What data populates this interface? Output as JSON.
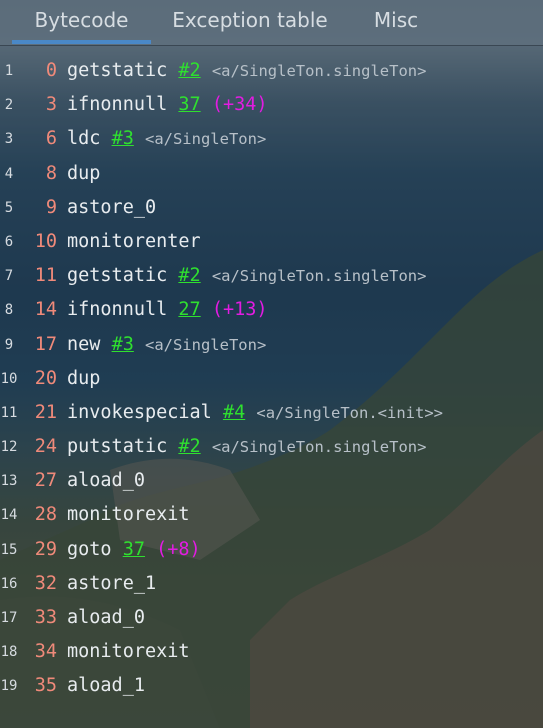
{
  "tabs": [
    {
      "label": "Bytecode",
      "selected": true
    },
    {
      "label": "Exception table",
      "selected": false
    },
    {
      "label": "Misc",
      "selected": false
    }
  ],
  "colors": {
    "offset": "#f08a7a",
    "instruction": "#e8ecef",
    "reference": "#2fe02f",
    "comment": "#b7c0c8",
    "jump": "#e21ce2",
    "tab_underline": "#4a88c7"
  },
  "lines": [
    {
      "num": "1",
      "offset": "0",
      "op": "getstatic",
      "ref": "#2",
      "comment": "<a/SingleTon.singleTon>",
      "jump": ""
    },
    {
      "num": "2",
      "offset": "3",
      "op": "ifnonnull",
      "ref": "37",
      "comment": "",
      "jump": "(+34)"
    },
    {
      "num": "3",
      "offset": "6",
      "op": "ldc",
      "ref": "#3",
      "comment": "<a/SingleTon>",
      "jump": ""
    },
    {
      "num": "4",
      "offset": "8",
      "op": "dup",
      "ref": "",
      "comment": "",
      "jump": ""
    },
    {
      "num": "5",
      "offset": "9",
      "op": "astore_0",
      "ref": "",
      "comment": "",
      "jump": ""
    },
    {
      "num": "6",
      "offset": "10",
      "op": "monitorenter",
      "ref": "",
      "comment": "",
      "jump": ""
    },
    {
      "num": "7",
      "offset": "11",
      "op": "getstatic",
      "ref": "#2",
      "comment": "<a/SingleTon.singleTon>",
      "jump": ""
    },
    {
      "num": "8",
      "offset": "14",
      "op": "ifnonnull",
      "ref": "27",
      "comment": "",
      "jump": "(+13)"
    },
    {
      "num": "9",
      "offset": "17",
      "op": "new",
      "ref": "#3",
      "comment": "<a/SingleTon>",
      "jump": ""
    },
    {
      "num": "10",
      "offset": "20",
      "op": "dup",
      "ref": "",
      "comment": "",
      "jump": ""
    },
    {
      "num": "11",
      "offset": "21",
      "op": "invokespecial",
      "ref": "#4",
      "comment": "<a/SingleTon.<init>>",
      "jump": ""
    },
    {
      "num": "12",
      "offset": "24",
      "op": "putstatic",
      "ref": "#2",
      "comment": "<a/SingleTon.singleTon>",
      "jump": ""
    },
    {
      "num": "13",
      "offset": "27",
      "op": "aload_0",
      "ref": "",
      "comment": "",
      "jump": ""
    },
    {
      "num": "14",
      "offset": "28",
      "op": "monitorexit",
      "ref": "",
      "comment": "",
      "jump": ""
    },
    {
      "num": "15",
      "offset": "29",
      "op": "goto",
      "ref": "37",
      "comment": "",
      "jump": "(+8)"
    },
    {
      "num": "16",
      "offset": "32",
      "op": "astore_1",
      "ref": "",
      "comment": "",
      "jump": ""
    },
    {
      "num": "17",
      "offset": "33",
      "op": "aload_0",
      "ref": "",
      "comment": "",
      "jump": ""
    },
    {
      "num": "18",
      "offset": "34",
      "op": "monitorexit",
      "ref": "",
      "comment": "",
      "jump": ""
    },
    {
      "num": "19",
      "offset": "35",
      "op": "aload_1",
      "ref": "",
      "comment": "",
      "jump": ""
    }
  ]
}
